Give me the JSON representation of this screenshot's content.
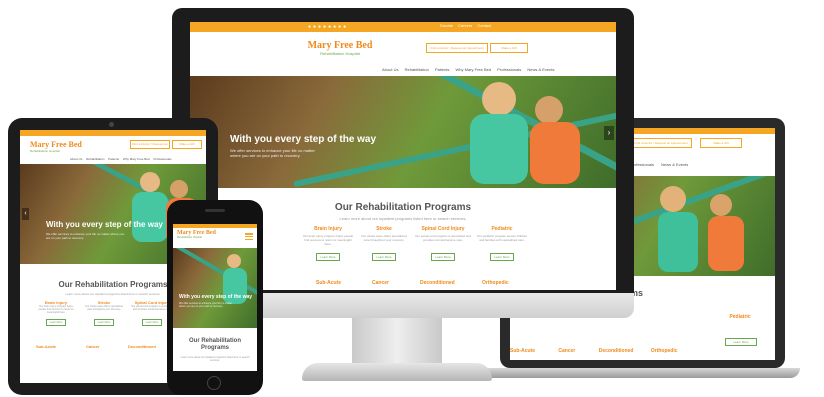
{
  "brand": {
    "name": "Mary Free Bed",
    "sub": "Rehabilitation Hospital"
  },
  "top_links": [
    "Donate",
    "Careers",
    "Contact"
  ],
  "header_buttons": [
    "Find a Doctor / Request an Appointment",
    "Make a Gift"
  ],
  "nav": [
    "About Us",
    "Rehabilitation",
    "Patients",
    "Why Mary Free Bed",
    "Professionals",
    "News & Events"
  ],
  "hero": {
    "title": "With you every step of the way",
    "subtitle": "We offer services to enhance your life no matter where you are on your path to recovery."
  },
  "programs": {
    "title": "Our Rehabilitation Programs",
    "subtitle": "Learn more about our inpatient programs listed here or search services.",
    "items": [
      {
        "name": "Brain Injury",
        "desc": "Our brain injury program helps people find success to return to meaningful lives."
      },
      {
        "name": "Stroke",
        "desc": "Our stroke team offers specialized care throughout your recovery."
      },
      {
        "name": "Spinal Cord Injury",
        "desc": "Our spinal cord program is accredited and provides comprehensive care."
      },
      {
        "name": "Pediatric",
        "desc": "Our pediatric program serves children and families with specialized care."
      },
      {
        "name": "Sub-Acute",
        "desc": ""
      },
      {
        "name": "Cancer",
        "desc": ""
      },
      {
        "name": "Deconditioned",
        "desc": ""
      },
      {
        "name": "Orthopedic",
        "desc": ""
      }
    ],
    "learn_more": "Learn More"
  },
  "colors": {
    "accent": "#f5a623",
    "green": "#6aa84f",
    "teal": "#3aa387",
    "device_dark": "#1c1c1c"
  },
  "icons": [
    "menu-icon",
    "camera-icon",
    "home-button-icon"
  ]
}
